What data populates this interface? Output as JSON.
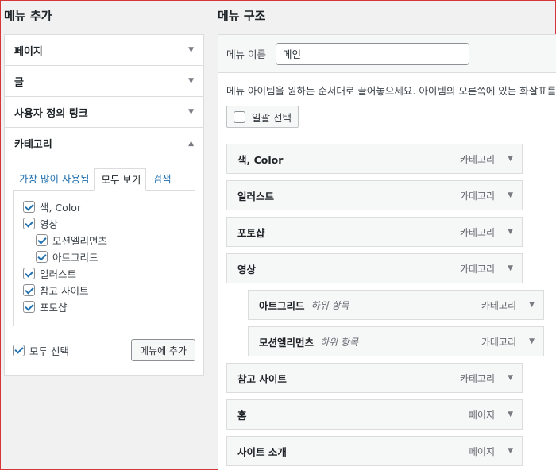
{
  "left": {
    "heading": "메뉴 추가",
    "sections": [
      {
        "label": "페이지",
        "expanded": false
      },
      {
        "label": "글",
        "expanded": false
      },
      {
        "label": "사용자 정의 링크",
        "expanded": false
      },
      {
        "label": "카테고리",
        "expanded": true
      }
    ],
    "tabs": [
      {
        "label": "가장 많이 사용됨",
        "active": false
      },
      {
        "label": "모두 보기",
        "active": true
      },
      {
        "label": "검색",
        "active": false
      }
    ],
    "categories": [
      {
        "label": "색, Color",
        "checked": true,
        "child": false
      },
      {
        "label": "영상",
        "checked": true,
        "child": false
      },
      {
        "label": "모션엘리먼츠",
        "checked": true,
        "child": true
      },
      {
        "label": "아트그리드",
        "checked": true,
        "child": true
      },
      {
        "label": "일러스트",
        "checked": true,
        "child": false
      },
      {
        "label": "참고 사이트",
        "checked": true,
        "child": false
      },
      {
        "label": "포토샵",
        "checked": true,
        "child": false
      }
    ],
    "select_all_label": "모두 선택",
    "add_button": "메뉴에 추가"
  },
  "right": {
    "heading": "메뉴 구조",
    "name_label": "메뉴 이름",
    "name_value": "메인",
    "instructions": "메뉴 아이템을 원하는 순서대로 끌어놓으세요. 아이템의 오른쪽에 있는 화살표를",
    "bulk_select": "일괄 선택",
    "items": [
      {
        "title": "색, Color",
        "type": "카테고리",
        "sub": "",
        "depth": 0
      },
      {
        "title": "일러스트",
        "type": "카테고리",
        "sub": "",
        "depth": 0
      },
      {
        "title": "포토샵",
        "type": "카테고리",
        "sub": "",
        "depth": 0
      },
      {
        "title": "영상",
        "type": "카테고리",
        "sub": "",
        "depth": 0
      },
      {
        "title": "아트그리드",
        "type": "카테고리",
        "sub": "하위 항목",
        "depth": 1
      },
      {
        "title": "모션엘리먼츠",
        "type": "카테고리",
        "sub": "하위 항목",
        "depth": 1
      },
      {
        "title": "참고 사이트",
        "type": "카테고리",
        "sub": "",
        "depth": 0
      },
      {
        "title": "홈",
        "type": "페이지",
        "sub": "",
        "depth": 0
      },
      {
        "title": "사이트 소개",
        "type": "페이지",
        "sub": "",
        "depth": 0
      }
    ]
  }
}
